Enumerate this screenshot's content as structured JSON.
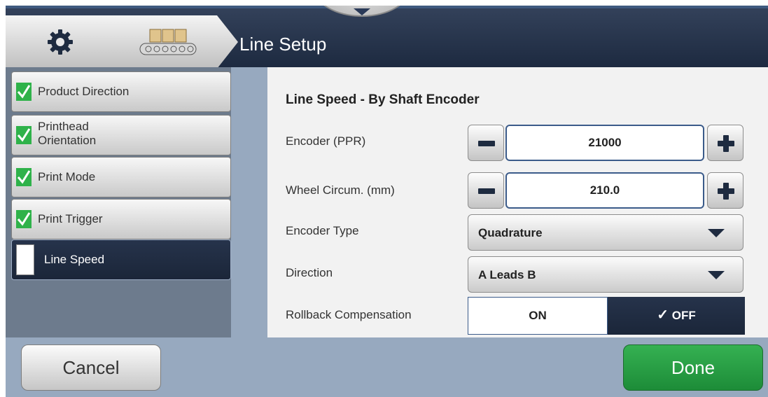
{
  "header": {
    "title": "Line Setup",
    "breadcrumb_icons": [
      "gear-icon",
      "conveyor-icon"
    ]
  },
  "sidebar": {
    "items": [
      {
        "label": "Product Direction",
        "status": "complete"
      },
      {
        "label": "Printhead Orientation",
        "status": "complete"
      },
      {
        "label": "Print Mode",
        "status": "complete"
      },
      {
        "label": "Print Trigger",
        "status": "complete"
      },
      {
        "label": "Line Speed",
        "status": "active"
      }
    ]
  },
  "panel": {
    "title": "Line Speed - By Shaft Encoder",
    "encoder_ppr": {
      "label": "Encoder (PPR)",
      "value": "21000"
    },
    "wheel_circum": {
      "label": "Wheel Circum. (mm)",
      "value": "210.0"
    },
    "encoder_type": {
      "label": "Encoder Type",
      "value": "Quadrature"
    },
    "direction": {
      "label": "Direction",
      "value": "A Leads B"
    },
    "rollback": {
      "label": "Rollback Compensation",
      "on_label": "ON",
      "off_label": "OFF",
      "selected": "OFF"
    }
  },
  "footer": {
    "cancel_label": "Cancel",
    "done_label": "Done"
  },
  "colors": {
    "header_bg": "#1d2a40",
    "accent_check": "#2fb24a",
    "done_green": "#1d8c38",
    "field_border": "#3b5b8a"
  }
}
